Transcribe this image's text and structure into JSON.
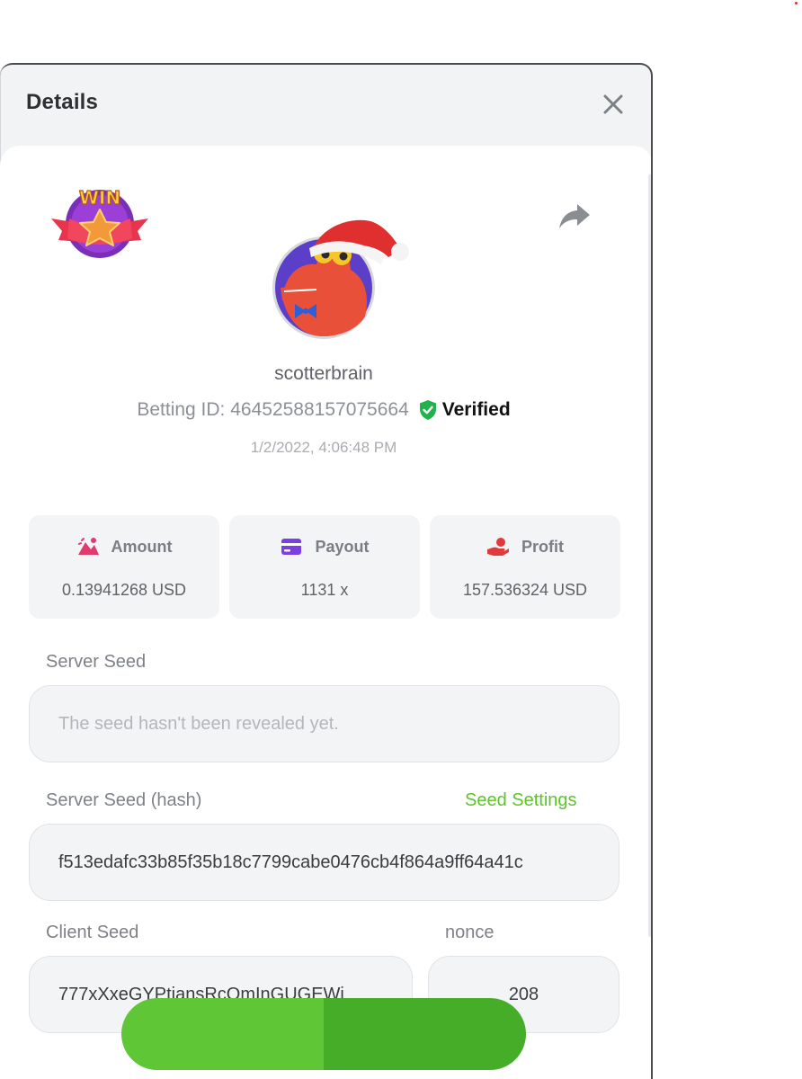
{
  "modal": {
    "title": "Details"
  },
  "player": {
    "username": "scotterbrain",
    "betting_id": "Betting ID: 46452588157075664",
    "verified_label": "Verified",
    "timestamp": "1/2/2022, 4:06:48 PM",
    "badge_text": "WIN"
  },
  "stats": [
    {
      "label": "Amount",
      "value": "0.13941268 USD",
      "icon": "bet-amount-icon"
    },
    {
      "label": "Payout",
      "value": "1131 x",
      "icon": "wallet-card-icon"
    },
    {
      "label": "Profit",
      "value": "157.536324 USD",
      "icon": "hand-coin-icon"
    }
  ],
  "seeds": {
    "server_seed_label": "Server Seed",
    "server_seed_placeholder": "The seed hasn't been revealed yet.",
    "server_hash_label": "Server Seed (hash)",
    "seed_settings_link": "Seed Settings",
    "server_hash_value": "f513edafc33b85f35b18c7799cabe0476cb4f864a9ff64a41c",
    "client_seed_label": "Client Seed",
    "client_seed_value": "777xXxeGYPtiansRcOmInGUGEWi",
    "nonce_label": "nonce",
    "nonce_value": "208"
  },
  "colors": {
    "accent_green": "#5cc528",
    "verified_green": "#22b24c",
    "amount_icon": "#e23a6e",
    "payout_icon": "#7b3fe4",
    "profit_icon": "#e03a3a"
  }
}
